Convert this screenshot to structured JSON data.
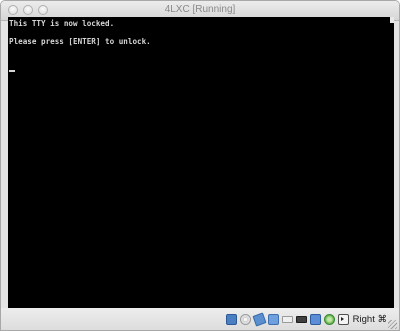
{
  "window": {
    "title": "4LXC [Running]"
  },
  "console": {
    "lines": [
      "This TTY is now locked.",
      "",
      "Please press [ENTER] to unlock."
    ]
  },
  "statusbar": {
    "icons": [
      "hard-disk-icon",
      "optical-drive-icon",
      "floppy-icon",
      "network-icon",
      "usb-icon",
      "display-icon",
      "shared-folders-icon",
      "virtualization-icon",
      "mouse-integration-icon"
    ],
    "host_key": "Right ⌘"
  },
  "colors": {
    "console_bg": "#000000",
    "console_text": "#d6d6d6",
    "chrome": "#e4e4e4"
  }
}
